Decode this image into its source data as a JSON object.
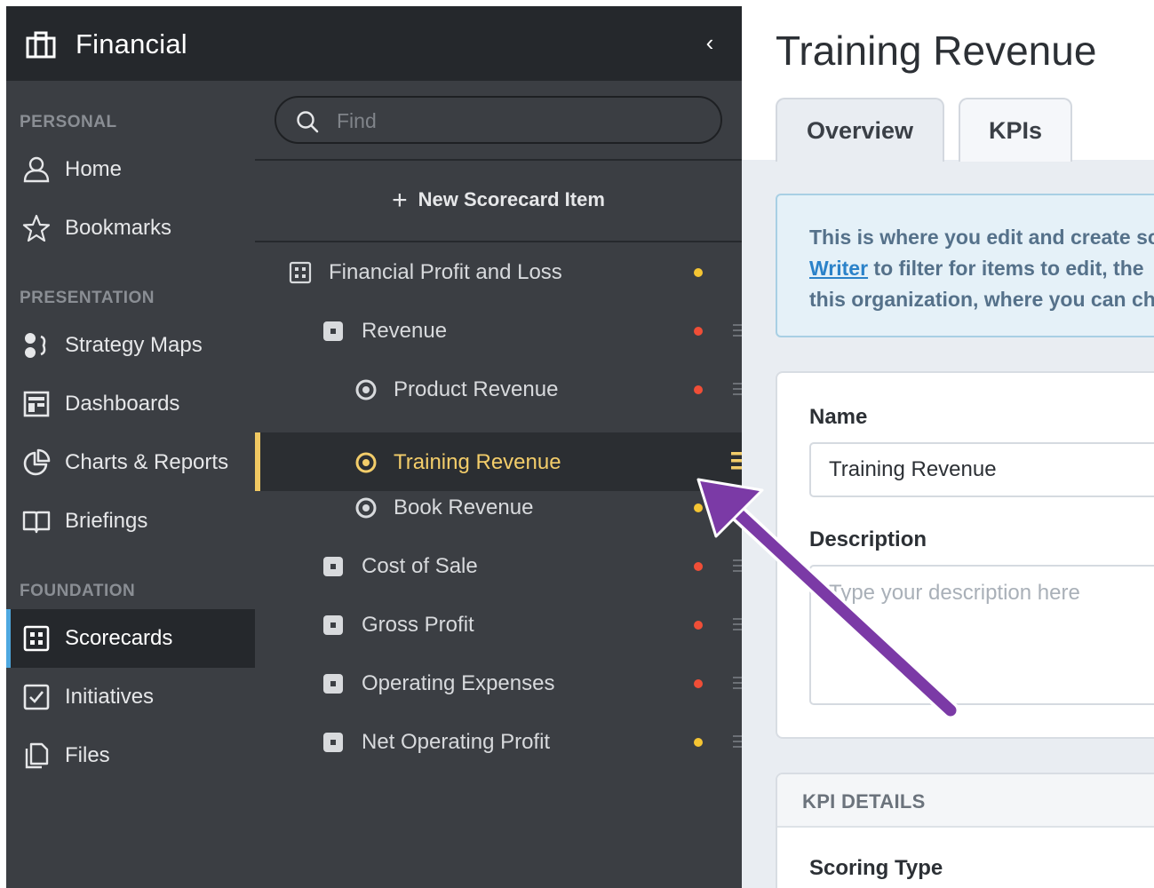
{
  "app": {
    "title": "Financial"
  },
  "nav": {
    "sections": {
      "personal": "PERSONAL",
      "presentation": "PRESENTATION",
      "foundation": "FOUNDATION"
    },
    "items": [
      {
        "label": "Home",
        "icon": "user-icon"
      },
      {
        "label": "Bookmarks",
        "icon": "star-icon"
      },
      {
        "label": "Strategy Maps",
        "icon": "strategy-map-icon"
      },
      {
        "label": "Dashboards",
        "icon": "dashboard-icon"
      },
      {
        "label": "Charts & Reports",
        "icon": "pie-chart-icon"
      },
      {
        "label": "Briefings",
        "icon": "book-icon"
      },
      {
        "label": "Scorecards",
        "icon": "scorecard-icon",
        "active": true
      },
      {
        "label": "Initiatives",
        "icon": "checkbox-icon"
      },
      {
        "label": "Files",
        "icon": "files-icon"
      }
    ]
  },
  "tree": {
    "search_placeholder": "Find",
    "new_item_label": "New Scorecard Item",
    "rows": [
      {
        "label": "Financial Profit and Loss",
        "level": 0,
        "icon": "scorecard-icon",
        "status": "yellow"
      },
      {
        "label": "Revenue",
        "level": 1,
        "icon": "objective-icon",
        "status": "red"
      },
      {
        "label": "Product Revenue",
        "level": 2,
        "icon": "kpi-icon",
        "status": "red"
      },
      {
        "label": "Training Revenue",
        "level": 2,
        "icon": "kpi-icon",
        "status": "none",
        "selected": true
      },
      {
        "label": "Book Revenue",
        "level": 2,
        "icon": "kpi-icon",
        "status": "yellow"
      },
      {
        "label": "Cost of Sale",
        "level": 1,
        "icon": "objective-icon",
        "status": "red"
      },
      {
        "label": "Gross Profit",
        "level": 1,
        "icon": "objective-icon",
        "status": "red"
      },
      {
        "label": "Operating Expenses",
        "level": 1,
        "icon": "objective-icon",
        "status": "red"
      },
      {
        "label": "Net Operating Profit",
        "level": 1,
        "icon": "objective-icon",
        "status": "yellow"
      }
    ]
  },
  "main": {
    "title": "Training Revenue",
    "tabs": [
      {
        "label": "Overview",
        "active": true
      },
      {
        "label": "KPIs"
      }
    ],
    "info": {
      "line1": "This is where you edit and create sc",
      "link": "Writer",
      "line2_rest": " to filter for items to edit, the",
      "line3": "this organization, where you can ch"
    },
    "form": {
      "name_label": "Name",
      "name_value": "Training Revenue",
      "description_label": "Description",
      "description_placeholder": "Type your description here"
    },
    "kpi_details": {
      "header": "KPI DETAILS",
      "scoring_type_label": "Scoring Type"
    }
  },
  "colors": {
    "status_red": "#f04e37",
    "status_yellow": "#f5c533",
    "selected_accent": "#f3cd6a",
    "active_nav_bar": "#4ea8e0",
    "annotation_arrow": "#7b3aa6"
  }
}
